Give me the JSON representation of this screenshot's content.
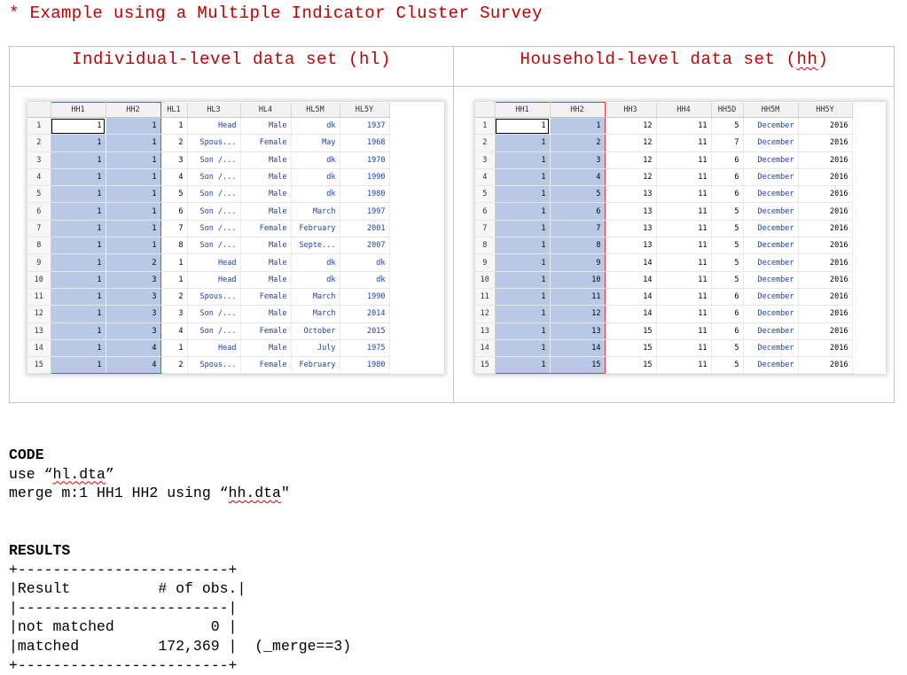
{
  "title": "* Example using a Multiple Indicator Cluster Survey",
  "left_panel": {
    "heading_prefix": "Individual-level data set (",
    "heading_underlined": "hl",
    "heading_suffix": ")",
    "columns": [
      "HH1",
      "HH2",
      "HL1",
      "HL3",
      "HL4",
      "HL5M",
      "HL5Y"
    ],
    "rows": [
      [
        "1",
        "1",
        "1",
        "Head",
        "Male",
        "dk",
        "1937"
      ],
      [
        "1",
        "1",
        "2",
        "Spous...",
        "Female",
        "May",
        "1968"
      ],
      [
        "1",
        "1",
        "3",
        "Son /...",
        "Male",
        "dk",
        "1970"
      ],
      [
        "1",
        "1",
        "4",
        "Son /...",
        "Male",
        "dk",
        "1990"
      ],
      [
        "1",
        "1",
        "5",
        "Son /...",
        "Male",
        "dk",
        "1980"
      ],
      [
        "1",
        "1",
        "6",
        "Son /...",
        "Male",
        "March",
        "1997"
      ],
      [
        "1",
        "1",
        "7",
        "Son /...",
        "Female",
        "February",
        "2001"
      ],
      [
        "1",
        "1",
        "8",
        "Son /...",
        "Male",
        "Septe...",
        "2007"
      ],
      [
        "1",
        "2",
        "1",
        "Head",
        "Male",
        "dk",
        "dk"
      ],
      [
        "1",
        "3",
        "1",
        "Head",
        "Male",
        "dk",
        "dk"
      ],
      [
        "1",
        "3",
        "2",
        "Spous...",
        "Female",
        "March",
        "1990"
      ],
      [
        "1",
        "3",
        "3",
        "Son /...",
        "Male",
        "March",
        "2014"
      ],
      [
        "1",
        "3",
        "4",
        "Son /...",
        "Female",
        "October",
        "2015"
      ],
      [
        "1",
        "4",
        "1",
        "Head",
        "Male",
        "July",
        "1975"
      ],
      [
        "1",
        "4",
        "2",
        "Spous...",
        "Female",
        "February",
        "1980"
      ]
    ]
  },
  "right_panel": {
    "heading_prefix": "Household-level data set (",
    "heading_underlined": "hh",
    "heading_suffix": ")",
    "columns": [
      "HH1",
      "HH2",
      "HH3",
      "HH4",
      "HH5D",
      "HH5M",
      "HH5Y"
    ],
    "rows": [
      [
        "1",
        "1",
        "12",
        "11",
        "5",
        "December",
        "2016"
      ],
      [
        "1",
        "2",
        "12",
        "11",
        "7",
        "December",
        "2016"
      ],
      [
        "1",
        "3",
        "12",
        "11",
        "6",
        "December",
        "2016"
      ],
      [
        "1",
        "4",
        "12",
        "11",
        "6",
        "December",
        "2016"
      ],
      [
        "1",
        "5",
        "13",
        "11",
        "6",
        "December",
        "2016"
      ],
      [
        "1",
        "6",
        "13",
        "11",
        "5",
        "December",
        "2016"
      ],
      [
        "1",
        "7",
        "13",
        "11",
        "5",
        "December",
        "2016"
      ],
      [
        "1",
        "8",
        "13",
        "11",
        "5",
        "December",
        "2016"
      ],
      [
        "1",
        "9",
        "14",
        "11",
        "5",
        "December",
        "2016"
      ],
      [
        "1",
        "10",
        "14",
        "11",
        "5",
        "December",
        "2016"
      ],
      [
        "1",
        "11",
        "14",
        "11",
        "6",
        "December",
        "2016"
      ],
      [
        "1",
        "12",
        "14",
        "11",
        "6",
        "December",
        "2016"
      ],
      [
        "1",
        "13",
        "15",
        "11",
        "6",
        "December",
        "2016"
      ],
      [
        "1",
        "14",
        "15",
        "11",
        "5",
        "December",
        "2016"
      ],
      [
        "1",
        "15",
        "15",
        "11",
        "5",
        "December",
        "2016"
      ]
    ]
  },
  "code": {
    "heading": "CODE",
    "line1_prefix": "use “",
    "line1_file": "hl.dta",
    "line1_suffix": "”",
    "line2_prefix": "merge m:1 HH1 HH2 using “",
    "line2_file": "hh.dta",
    "line2_suffix": "\""
  },
  "results": {
    "heading": "RESULTS",
    "lines": [
      "+------------------------+",
      "|Result          # of obs.|",
      "|------------------------|",
      "|not matched           0 |",
      "|matched         172,369 |  (_merge==3)",
      "+------------------------+"
    ]
  }
}
